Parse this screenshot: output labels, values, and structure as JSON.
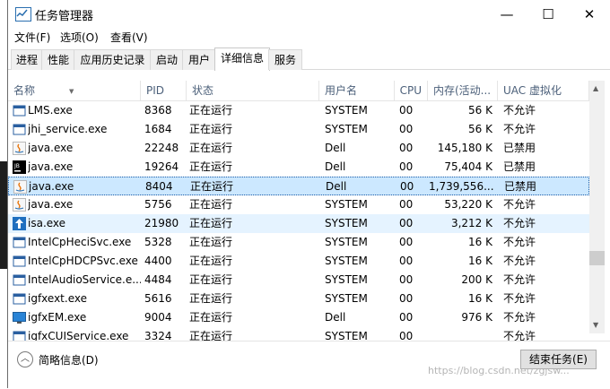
{
  "window": {
    "title": "任务管理器",
    "controls": {
      "minimize": "—",
      "maximize": "☐",
      "close": "✕"
    }
  },
  "menu": [
    "文件(F)",
    "选项(O)",
    "查看(V)"
  ],
  "tabs": [
    "进程",
    "性能",
    "应用历史记录",
    "启动",
    "用户",
    "详细信息",
    "服务"
  ],
  "active_tab": "详细信息",
  "table": {
    "columns": [
      "名称",
      "PID",
      "状态",
      "用户名",
      "CPU",
      "内存(活动...",
      "UAC 虚拟化"
    ],
    "rows": [
      {
        "name": "LMS.exe",
        "pid": "8368",
        "status": "正在运行",
        "user": "SYSTEM",
        "cpu": "00",
        "mem": "56 K",
        "uac": "不允许",
        "icon": "window-icon"
      },
      {
        "name": "jhi_service.exe",
        "pid": "1684",
        "status": "正在运行",
        "user": "SYSTEM",
        "cpu": "00",
        "mem": "56 K",
        "uac": "不允许",
        "icon": "window-icon"
      },
      {
        "name": "java.exe",
        "pid": "22248",
        "status": "正在运行",
        "user": "Dell",
        "cpu": "00",
        "mem": "145,180 K",
        "uac": "已禁用",
        "icon": "java-icon"
      },
      {
        "name": "java.exe",
        "pid": "19264",
        "status": "正在运行",
        "user": "Dell",
        "cpu": "00",
        "mem": "75,404 K",
        "uac": "已禁用",
        "icon": "jetbrains-icon"
      },
      {
        "name": "java.exe",
        "pid": "8404",
        "status": "正在运行",
        "user": "Dell",
        "cpu": "00",
        "mem": "1,739,556...",
        "uac": "已禁用",
        "icon": "java-icon"
      },
      {
        "name": "java.exe",
        "pid": "5756",
        "status": "正在运行",
        "user": "SYSTEM",
        "cpu": "00",
        "mem": "53,220 K",
        "uac": "不允许",
        "icon": "java-icon"
      },
      {
        "name": "isa.exe",
        "pid": "21980",
        "status": "正在运行",
        "user": "SYSTEM",
        "cpu": "00",
        "mem": "3,212 K",
        "uac": "不允许",
        "icon": "arrow-up-icon"
      },
      {
        "name": "IntelCpHeciSvc.exe",
        "pid": "5328",
        "status": "正在运行",
        "user": "SYSTEM",
        "cpu": "00",
        "mem": "16 K",
        "uac": "不允许",
        "icon": "window-icon"
      },
      {
        "name": "IntelCpHDCPSvc.exe",
        "pid": "4400",
        "status": "正在运行",
        "user": "SYSTEM",
        "cpu": "00",
        "mem": "16 K",
        "uac": "不允许",
        "icon": "window-icon"
      },
      {
        "name": "IntelAudioService.e...",
        "pid": "4484",
        "status": "正在运行",
        "user": "SYSTEM",
        "cpu": "00",
        "mem": "200 K",
        "uac": "不允许",
        "icon": "window-icon"
      },
      {
        "name": "igfxext.exe",
        "pid": "5616",
        "status": "正在运行",
        "user": "SYSTEM",
        "cpu": "00",
        "mem": "16 K",
        "uac": "不允许",
        "icon": "window-icon"
      },
      {
        "name": "igfxEM.exe",
        "pid": "9004",
        "status": "正在运行",
        "user": "Dell",
        "cpu": "00",
        "mem": "976 K",
        "uac": "不允许",
        "icon": "monitor-icon"
      },
      {
        "name": "igfxCUIService.exe",
        "pid": "3324",
        "status": "正在运行",
        "user": "SYSTEM",
        "cpu": "00",
        "mem": "",
        "uac": "不允许",
        "icon": "window-icon"
      }
    ],
    "selected_row": 4,
    "hovered_row": 6
  },
  "footer": {
    "collapse_label": "简略信息(D)",
    "end_task_label": "结束任务(E)",
    "watermark": "https://blog.csdn.net/zgjsw..."
  },
  "colors": {
    "header_text": "#4c607a",
    "selected_bg": "#cce8ff",
    "hover_bg": "#e5f3ff"
  }
}
